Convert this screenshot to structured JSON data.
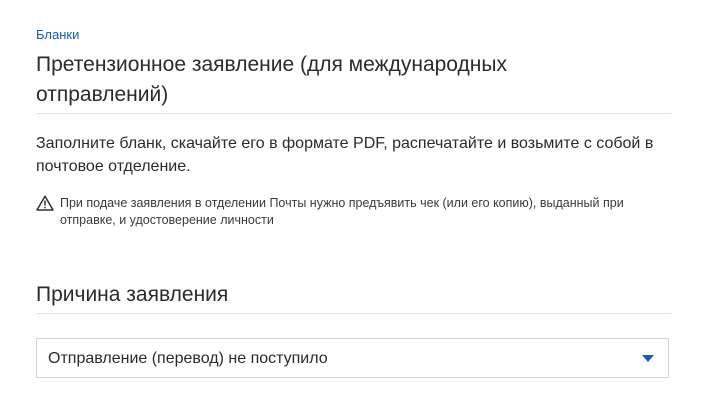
{
  "breadcrumb": {
    "label": "Бланки"
  },
  "header": {
    "title": "Претензионное заявление (для международных отправлений)"
  },
  "intro": {
    "text": "Заполните бланк, скачайте его в формате PDF, распечатайте и возьмите с собой в почтовое отделение."
  },
  "notice": {
    "icon": "warning-triangle-icon",
    "text": "При подаче заявления в отделении Почты нужно предъявить чек (или его копию), выданный при отправке, и удостоверение личности"
  },
  "reason_section": {
    "title": "Причина заявления",
    "select": {
      "value": "Отправление (перевод) не поступило",
      "icon": "chevron-down-icon"
    }
  },
  "colors": {
    "accent": "#1a5bb5",
    "text": "#2b2b2b",
    "divider": "#e3e3e3",
    "border": "#d3d3d3"
  }
}
